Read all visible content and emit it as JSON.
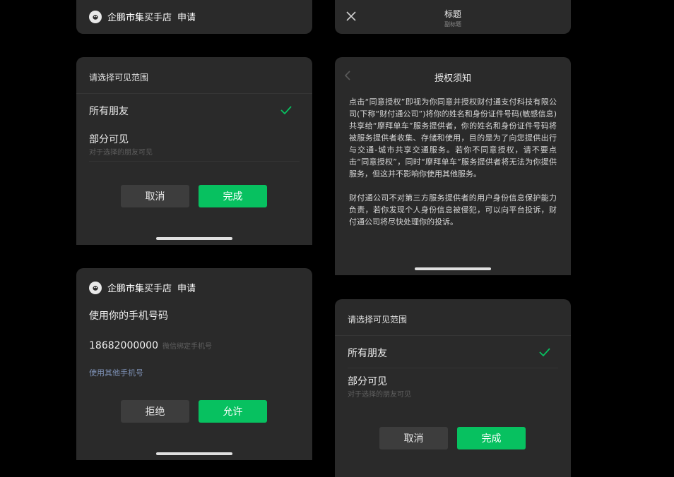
{
  "left_top": {
    "brand": "企鹏市集买手店",
    "action": "申请"
  },
  "right_top": {
    "title": "标题",
    "subtitle": "副标题"
  },
  "visibility_panel": {
    "title": "请选择可见范围",
    "option_all": "所有朋友",
    "option_partial": "部分可见",
    "option_partial_sub": "对于选择的朋友可见",
    "cancel": "取消",
    "done": "完成"
  },
  "auth_panel": {
    "title": "授权须知",
    "paragraph1": "点击“同意授权”即视为你同意并授权财付通支付科技有限公司(下称“财付通公司”)将你的姓名和身份证件号码(敏感信息)共享给“摩拜单车”服务提供者，你的姓名和身份证件号码将被服务提供者收集、存储和使用，目的是为了向您提供出行与交通-城市共享交通服务。若你不同意授权，请不要点击“同意授权”，同时“摩拜单车”服务提供者将无法为你提供服务，但这并不影响你使用其他服务。",
    "paragraph2": "财付通公司不对第三方服务提供者的用户身份信息保护能力负责，若你发现个人身份信息被侵犯，可以向平台投诉，财付通公司将尽快处理你的投诉。"
  },
  "phone_panel": {
    "brand": "企鹏市集买手店",
    "action": "申请",
    "heading": "使用你的手机号码",
    "number": "18682000000",
    "number_hint": "微信绑定手机号",
    "other_link": "使用其他手机号",
    "reject": "拒绝",
    "allow": "允许"
  },
  "colors": {
    "background": "#000000",
    "panel": "#2a2a2a",
    "accent_green": "#07c160",
    "link_blue": "#7c8fb3"
  },
  "icons": {
    "brand_logo": "penguin-logo-icon",
    "close": "close-icon",
    "back": "chevron-left-icon",
    "check": "check-icon"
  }
}
